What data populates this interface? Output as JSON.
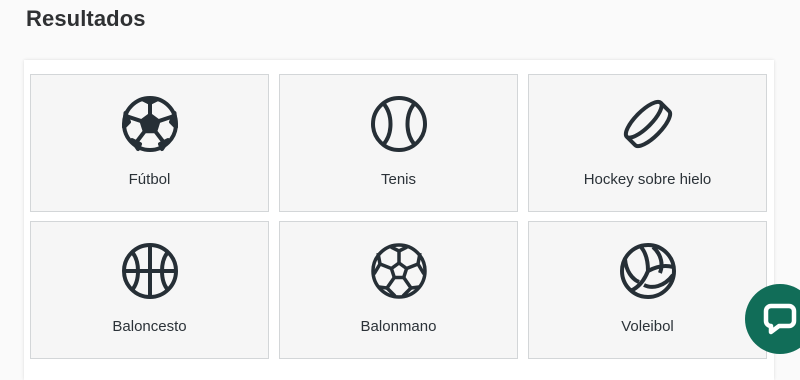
{
  "page": {
    "title": "Resultados"
  },
  "colors": {
    "tile_bg": "#f6f6f6",
    "icon_stroke": "#262f36",
    "chat_bg": "#116d58"
  },
  "sports": [
    {
      "label": "Fútbol",
      "icon": "soccer-ball-icon"
    },
    {
      "label": "Tenis",
      "icon": "tennis-ball-icon"
    },
    {
      "label": "Hockey sobre hielo",
      "icon": "hockey-puck-icon"
    },
    {
      "label": "Baloncesto",
      "icon": "basketball-icon"
    },
    {
      "label": "Balonmano",
      "icon": "handball-icon"
    },
    {
      "label": "Voleibol",
      "icon": "volleyball-icon"
    }
  ],
  "chat": {
    "icon": "chat-bubble-icon"
  }
}
